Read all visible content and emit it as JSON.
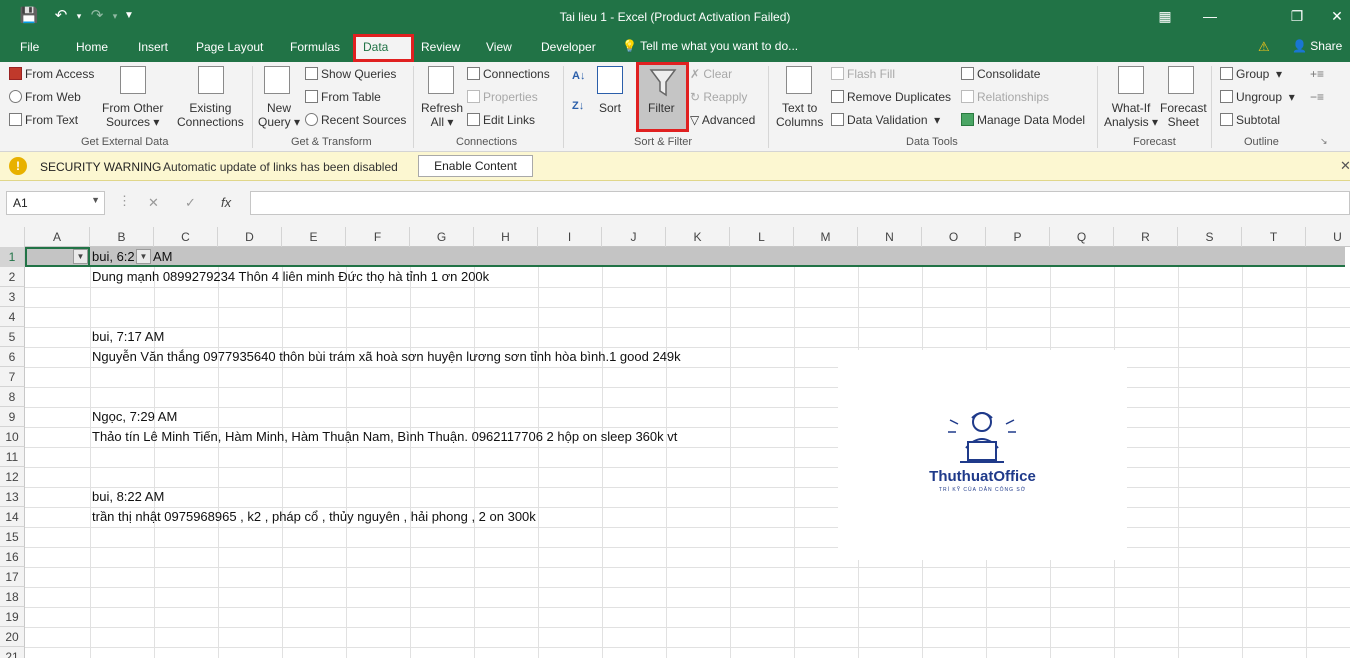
{
  "window": {
    "title": "Tai lieu 1 - Excel (Product Activation Failed)"
  },
  "tabs": [
    "File",
    "Home",
    "Insert",
    "Page Layout",
    "Formulas",
    "Data",
    "Review",
    "View",
    "Developer"
  ],
  "active_tab": "Data",
  "tell_me": "Tell me what you want to do...",
  "share": "Share",
  "ribbon": {
    "get_external": {
      "from_access": "From Access",
      "from_web": "From Web",
      "from_text": "From Text",
      "from_other_1": "From Other",
      "from_other_2": "Sources",
      "existing_1": "Existing",
      "existing_2": "Connections",
      "label": "Get External Data"
    },
    "get_transform": {
      "new_query_1": "New",
      "new_query_2": "Query",
      "show_queries": "Show Queries",
      "from_table": "From Table",
      "recent_sources": "Recent Sources",
      "label": "Get & Transform"
    },
    "connections": {
      "refresh_1": "Refresh",
      "refresh_2": "All",
      "connections": "Connections",
      "properties": "Properties",
      "edit_links": "Edit Links",
      "label": "Connections"
    },
    "sort_filter": {
      "sort": "Sort",
      "filter": "Filter",
      "clear": "Clear",
      "reapply": "Reapply",
      "advanced": "Advanced",
      "label": "Sort & Filter"
    },
    "data_tools": {
      "text_to_1": "Text to",
      "text_to_2": "Columns",
      "flash_fill": "Flash Fill",
      "remove_duplicates": "Remove Duplicates",
      "data_validation": "Data Validation",
      "consolidate": "Consolidate",
      "relationships": "Relationships",
      "manage_model": "Manage Data Model",
      "label": "Data Tools"
    },
    "forecast": {
      "whatif_1": "What-If",
      "whatif_2": "Analysis",
      "forecast_1": "Forecast",
      "forecast_2": "Sheet",
      "label": "Forecast"
    },
    "outline": {
      "group": "Group",
      "ungroup": "Ungroup",
      "subtotal": "Subtotal",
      "label": "Outline"
    }
  },
  "security": {
    "title": "SECURITY WARNING",
    "message": "Automatic update of links has been disabled",
    "button": "Enable Content"
  },
  "formula_bar": {
    "name_box": "A1",
    "fx": "fx",
    "value": ""
  },
  "columns": [
    "A",
    "B",
    "C",
    "D",
    "E",
    "F",
    "G",
    "H",
    "I",
    "J",
    "K",
    "L",
    "M",
    "N",
    "O",
    "P",
    "Q",
    "R",
    "S",
    "T",
    "U"
  ],
  "rows": [
    "1",
    "2",
    "3",
    "4",
    "5",
    "6",
    "7",
    "8",
    "9",
    "10",
    "11",
    "12",
    "13",
    "14",
    "15",
    "16",
    "17",
    "18",
    "19",
    "20",
    "21"
  ],
  "cells": {
    "b1": "bui, 6:2",
    "b1_rest": "AM",
    "b2": "Dung mạnh 0899279234 Thôn 4 liên minh Đức thọ hà tỉnh 1 ơn 200k",
    "b5": "bui, 7:17 AM",
    "b6": "Nguyễn Văn thắng 0977935640 thôn bùi trám xã hoà sơn huyện lương sơn tỉnh hòa bình.1 good 249k",
    "b9": "Ngọc, 7:29 AM",
    "b10": "Thảo tín Lê Minh Tiến, Hàm Minh, Hàm Thuận Nam, Bình Thuận. 0962117706 2 hộp on sleep 360k vt",
    "b13": "bui, 8:22 AM",
    "b14": "trần thị nhật  0975968965 , k2 , pháp cổ , thủy nguyên , hải phong , 2 on 300k"
  },
  "logo": {
    "name": "ThuthuatOffice",
    "tagline": "TRÍ KỸ CỦA DÂN CÔNG SỞ"
  }
}
